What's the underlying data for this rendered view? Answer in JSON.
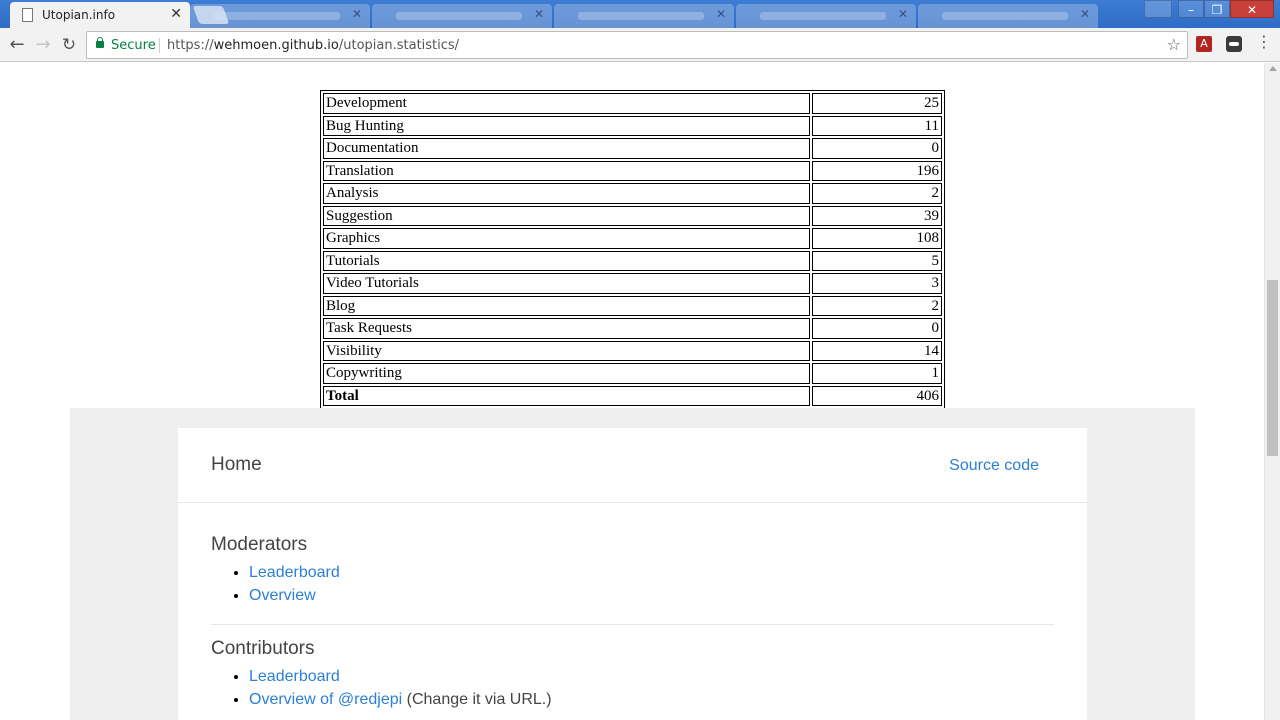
{
  "browser": {
    "active_tab": {
      "title": "Utopian.info",
      "icon": "page-icon"
    },
    "secure_label": "Secure",
    "url_scheme": "https://",
    "url_host": "wehmoen.github.io",
    "url_path": "/utopian.statistics/",
    "extension_pdf_glyph": "A"
  },
  "stats_table": {
    "rows": [
      {
        "name": "Development",
        "value": "25"
      },
      {
        "name": "Bug Hunting",
        "value": "11"
      },
      {
        "name": "Documentation",
        "value": "0"
      },
      {
        "name": "Translation",
        "value": "196"
      },
      {
        "name": "Analysis",
        "value": "2"
      },
      {
        "name": "Suggestion",
        "value": "39"
      },
      {
        "name": "Graphics",
        "value": "108"
      },
      {
        "name": "Tutorials",
        "value": "5"
      },
      {
        "name": "Video Tutorials",
        "value": "3"
      },
      {
        "name": "Blog",
        "value": "2"
      },
      {
        "name": "Task Requests",
        "value": "0"
      },
      {
        "name": "Visibility",
        "value": "14"
      },
      {
        "name": "Copywriting",
        "value": "1"
      }
    ],
    "total": {
      "name": "Total",
      "value": "406"
    }
  },
  "nav_card": {
    "home_title": "Home",
    "source_link": "Source code",
    "moderators": {
      "heading": "Moderators",
      "links": [
        "Leaderboard",
        "Overview"
      ]
    },
    "contributors": {
      "heading": "Contributors",
      "leaderboard_link": "Leaderboard",
      "overview_link": "Overview of @redjepi",
      "overview_note": " (Change it via URL.)"
    }
  },
  "colors": {
    "link": "#2b7fd4",
    "secure_green": "#0b8043",
    "tabstrip_blue": "#3d7dd6"
  }
}
